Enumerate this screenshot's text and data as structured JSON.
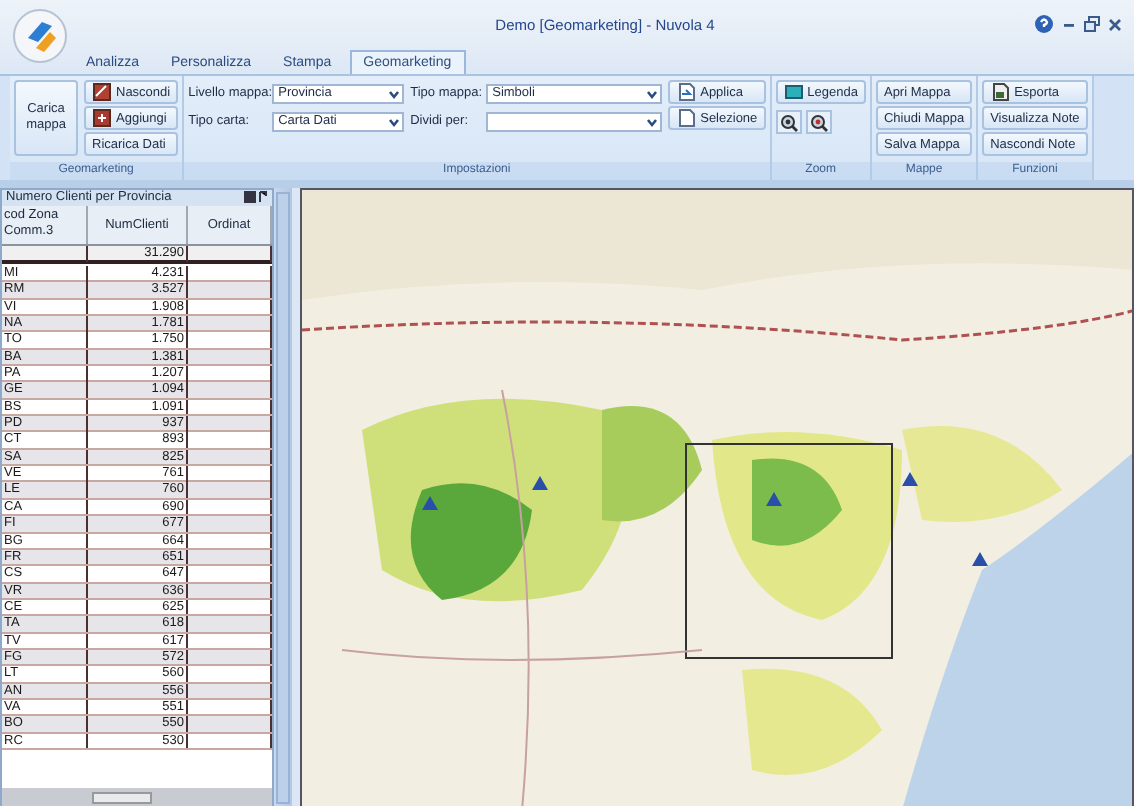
{
  "window": {
    "title": "Demo [Geomarketing] - Nuvola 4"
  },
  "tabs": [
    {
      "label": "Analizza",
      "selected": false
    },
    {
      "label": "Personalizza",
      "selected": false
    },
    {
      "label": "Stampa",
      "selected": false
    },
    {
      "label": "Geomarketing",
      "selected": true
    }
  ],
  "ribbon": {
    "groups": [
      {
        "label": "Geomarketing",
        "columns": [
          [
            {
              "kind": "large-button",
              "label": "Carica mappa"
            }
          ],
          [
            {
              "kind": "icon-button",
              "label": "Nascondi"
            },
            {
              "kind": "icon-button",
              "label": "Aggiungi"
            },
            {
              "kind": "button",
              "label": "Ricarica Dati"
            }
          ]
        ]
      },
      {
        "label": "Impostazioni",
        "columns": [
          [
            {
              "kind": "combo",
              "label": "Livello mappa:",
              "value": "Provincia"
            },
            {
              "kind": "combo",
              "label": "Tipo carta:",
              "value": "Carta Dati"
            }
          ],
          [
            {
              "kind": "combo",
              "label": "Tipo mappa:",
              "value": "Simboli"
            },
            {
              "kind": "combo",
              "label": "Dividi per:"
            }
          ],
          [
            {
              "kind": "icon-button",
              "label": "Applica"
            },
            {
              "kind": "icon-button",
              "label": "Selezione"
            }
          ]
        ]
      },
      {
        "label": "Zoom",
        "columns": [
          [
            {
              "kind": "icon-button",
              "label": "Legenda"
            },
            {
              "kind": "tool"
            },
            {
              "kind": "tool"
            }
          ]
        ]
      },
      {
        "label": "Mappe",
        "columns": [
          [
            {
              "kind": "button",
              "label": "Apri Mappa"
            },
            {
              "kind": "button",
              "label": "Chiudi Mappa"
            },
            {
              "kind": "button",
              "label": "Salva Mappa"
            }
          ]
        ]
      },
      {
        "label": "Funzioni",
        "columns": [
          [
            {
              "kind": "icon-button",
              "label": "Esporta"
            },
            {
              "kind": "button",
              "label": "Visualizza Note"
            },
            {
              "kind": "button",
              "label": "Nascondi Note"
            }
          ]
        ]
      }
    ]
  },
  "table": {
    "title": "Numero Clienti per Provincia",
    "columns": [
      "cod Zona Comm.3",
      "NumClienti",
      "Ordinat"
    ],
    "total": "31.290",
    "rows": [
      [
        "MI",
        "4.231"
      ],
      [
        "RM",
        "3.527"
      ],
      [
        "VI",
        "1.908"
      ],
      [
        "NA",
        "1.781"
      ],
      [
        "TO",
        "1.750"
      ],
      [
        "BA",
        "1.381"
      ],
      [
        "PA",
        "1.207"
      ],
      [
        "GE",
        "1.094"
      ],
      [
        "BS",
        "1.091"
      ],
      [
        "PD",
        "937"
      ],
      [
        "CT",
        "893"
      ],
      [
        "SA",
        "825"
      ],
      [
        "VE",
        "761"
      ],
      [
        "LE",
        "760"
      ],
      [
        "CA",
        "690"
      ],
      [
        "FI",
        "677"
      ],
      [
        "BG",
        "664"
      ],
      [
        "FR",
        "651"
      ],
      [
        "CS",
        "647"
      ],
      [
        "VR",
        "636"
      ],
      [
        "CE",
        "625"
      ],
      [
        "TA",
        "618"
      ],
      [
        "TV",
        "617"
      ],
      [
        "FG",
        "572"
      ],
      [
        "LT",
        "560"
      ],
      [
        "AN",
        "556"
      ],
      [
        "VA",
        "551"
      ],
      [
        "BO",
        "550"
      ],
      [
        "RC",
        "530"
      ]
    ]
  }
}
